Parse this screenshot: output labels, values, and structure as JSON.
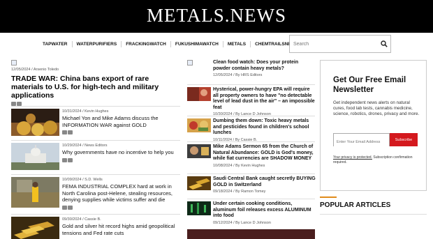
{
  "header": {
    "logo": "METALS.NEWS"
  },
  "nav": {
    "items": [
      "TAPWATER",
      "WATERPURIFIERS",
      "FRACKINGWATCH",
      "FUKUSHIMAWATCH",
      "METALS",
      "CHEMTRAILSNEWS"
    ]
  },
  "search": {
    "placeholder": "Search",
    "icon": "search-icon"
  },
  "lead": {
    "date": "12/05/2024",
    "author": "Arsenio Toledo",
    "title": "TRADE WAR: China bans export of rare materials to U.S. for high-tech and military applications"
  },
  "left_articles": [
    {
      "date": "10/31/2024",
      "author": "Kevin Hughes",
      "title": "Michael Yon and Mike Adams discuss the INFORMATION WAR against GOLD"
    },
    {
      "date": "10/29/2024",
      "author": "News Editors",
      "title": "Why governments have no incentive to help you"
    },
    {
      "date": "10/09/2024",
      "author": "S.D. Wells",
      "title": "FEMA INDUSTRIAL COMPLEX hard at work in North Carolina post-Helene, stealing resources, denying supplies while victims suffer and die"
    },
    {
      "date": "09/30/2024",
      "author": "Cassie B.",
      "title": "Gold and silver hit record highs amid geopolitical tensions and Fed rate cuts"
    }
  ],
  "right_articles": [
    {
      "date": "12/05/2024",
      "author": "By HRS Editors",
      "title": "Clean food watch: Does your protein powder contain heavy metals?"
    },
    {
      "date": "10/30/2024",
      "author": "By Lance D Johnson",
      "title": "Hysterical, power-hungry EPA will require all property owners to have \"no detectable level of lead dust in the air\" – an impossible feat"
    },
    {
      "date": "10/11/2024",
      "author": "By Cassie B.",
      "title": "Dumbing them down: Toxic heavy metals and pesticides found in children's school lunches"
    },
    {
      "date": "10/08/2024",
      "author": "By Kevin Hughes",
      "title": "Mike Adams Sermon 65 from the Church of Natural Abundance: GOLD is God's money, while fiat currencies are SHADOW MONEY"
    },
    {
      "date": "09/18/2024",
      "author": "By Ramon Tomey",
      "title": "Saudi Central Bank caught secretly BUYING GOLD in Switzerland"
    },
    {
      "date": "09/12/2024",
      "author": "By Lance D Johnson",
      "title": "Under certain cooking conditions, aluminum foil releases excess ALUMINUM into food"
    }
  ],
  "signup": {
    "heading": "Get Our Free Email Newsletter",
    "description": "Get independent news alerts on natural cures, food lab tests, cannabis medicine, science, robotics, drones, privacy and more.",
    "email_placeholder": "Enter Your Email Address",
    "button": "Subscribe",
    "privacy_link": "Your privacy is protected.",
    "privacy_rest": " Subscription confirmation required."
  },
  "popular": {
    "heading": "POPULAR ARTICLES"
  },
  "colors": {
    "accent_red": "#d4191e",
    "accent_orange": "#e08b1a",
    "header_bg": "#000000"
  }
}
